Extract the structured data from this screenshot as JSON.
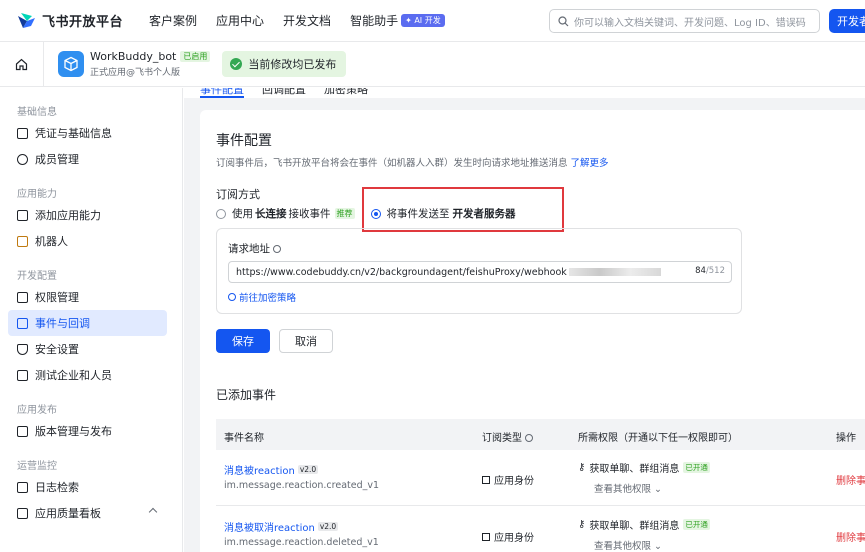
{
  "topbar": {
    "logo_text": "飞书开放平台",
    "nav": [
      "客户案例",
      "应用中心",
      "开发文档",
      "智能助手"
    ],
    "ai_badge": "✦ AI 开发",
    "search_placeholder": "你可以输入文档关键词、开发问题、Log ID、错误码",
    "dev_button": "开发者"
  },
  "app": {
    "name": "WorkBuddy_bot",
    "status_tag": "已启用",
    "subtitle": "正式应用@飞书个人版",
    "toast": "当前修改均已发布"
  },
  "sidebar": {
    "groups": [
      {
        "label": "基础信息",
        "items": [
          "凭证与基础信息",
          "成员管理"
        ]
      },
      {
        "label": "应用能力",
        "items": [
          "添加应用能力",
          "机器人"
        ]
      },
      {
        "label": "开发配置",
        "items": [
          "权限管理",
          "事件与回调",
          "安全设置",
          "测试企业和人员"
        ]
      },
      {
        "label": "应用发布",
        "items": [
          "版本管理与发布"
        ]
      },
      {
        "label": "运营监控",
        "items": [
          "日志检索",
          "应用质量看板"
        ]
      }
    ],
    "active": "事件与回调"
  },
  "tabs": [
    "事件配置",
    "回调配置",
    "加密策略"
  ],
  "event_config": {
    "title": "事件配置",
    "desc": "订阅事件后，飞书开放平台将会在事件（如机器人入群）发生时向请求地址推送消息",
    "learn_more": "了解更多",
    "sub_method_label": "订阅方式",
    "option1_a": "使用",
    "option1_b": "长连接",
    "option1_c": "接收事件",
    "option1_tag": "推荐",
    "option2_a": "将事件发送至",
    "option2_b": "开发者服务器",
    "url_label": "请求地址",
    "url_value": "https://www.codebuddy.cn/v2/backgroundagent/feishuProxy/webhook",
    "url_count": "84",
    "url_max": "/512",
    "encrypt_link": "前往加密策略",
    "save": "保存",
    "cancel": "取消"
  },
  "events": {
    "title": "已添加事件",
    "headers": [
      "事件名称",
      "订阅类型",
      "所需权限（开通以下任一权限即可）",
      "操作"
    ],
    "rows": [
      {
        "name": "消息被reaction",
        "version": "v2.0",
        "key": "im.message.reaction.created_v1",
        "type": "应用身份",
        "permission": "获取单聊、群组消息",
        "perm_status": "已开通",
        "more": "查看其他权限",
        "action": "删除事"
      },
      {
        "name": "消息被取消reaction",
        "version": "v2.0",
        "key": "im.message.reaction.deleted_v1",
        "type": "应用身份",
        "permission": "获取单聊、群组消息",
        "perm_status": "已开通",
        "more": "查看其他权限",
        "action": "删除事"
      }
    ]
  }
}
